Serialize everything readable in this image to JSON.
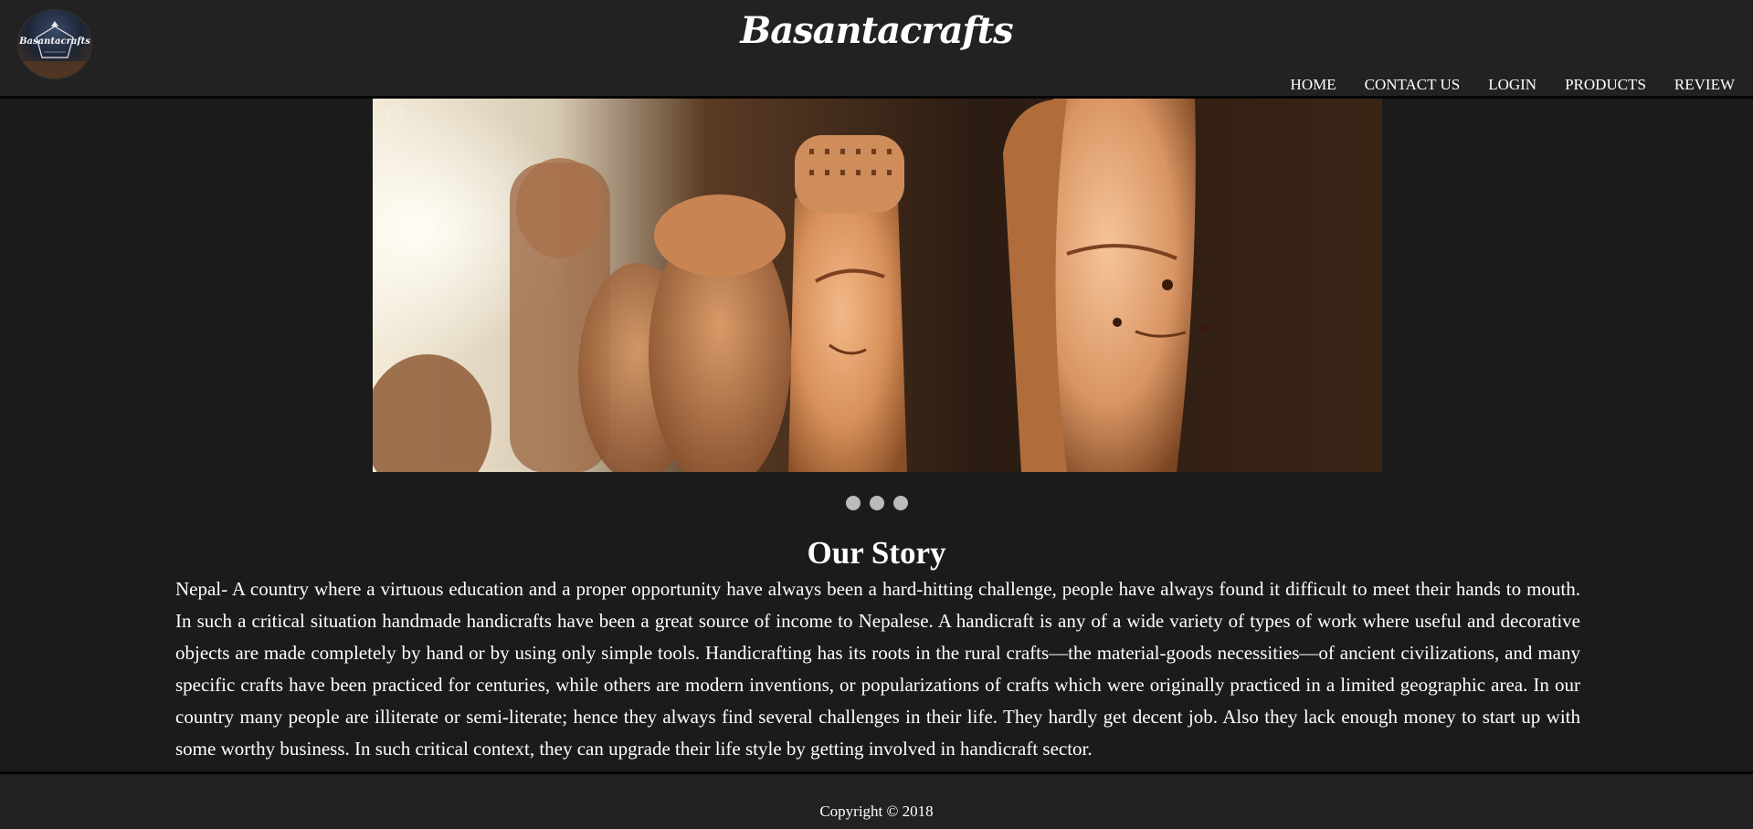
{
  "brand": {
    "title": "Basantacrafts",
    "logo_text": "Basantacrafts"
  },
  "nav": {
    "items": [
      "HOME",
      "CONTACT US",
      "LOGIN",
      "PRODUCTS",
      "REVIEW"
    ]
  },
  "slideshow": {
    "counter": "3 / 3",
    "slide_count": 3,
    "current_slide": 3,
    "subject": "carved wooden buddha heads"
  },
  "story": {
    "title": "Our Story",
    "text": "Nepal- A country where a virtuous education and a proper opportunity have always been a hard-hitting challenge, people have always found it difficult to meet their hands to mouth. In such a critical situation handmade handicrafts have been a great source of income to Nepalese. A handicraft is any of a wide variety of types of work where useful and decorative objects are made completely by hand or by using only simple tools. Handicrafting has its roots in the rural crafts—the material-goods necessities—of ancient civilizations, and many specific crafts have been practiced for centuries, while others are modern inventions, or popularizations of crafts which were originally practiced in a limited geographic area. In our country many people are illiterate or semi-literate; hence they always find several challenges in their life. They hardly get decent job. Also they lack enough money to start up with some worthy business. In such critical context, they can upgrade their life style by getting involved in handicraft sector."
  },
  "footer": {
    "copyright": "Copyright © 2018"
  },
  "colors": {
    "page_background": "#1b1b1b",
    "header_background": "#222222",
    "text": "#ffffff",
    "dot": "#bbbbbb",
    "wood": "#d9955e"
  }
}
